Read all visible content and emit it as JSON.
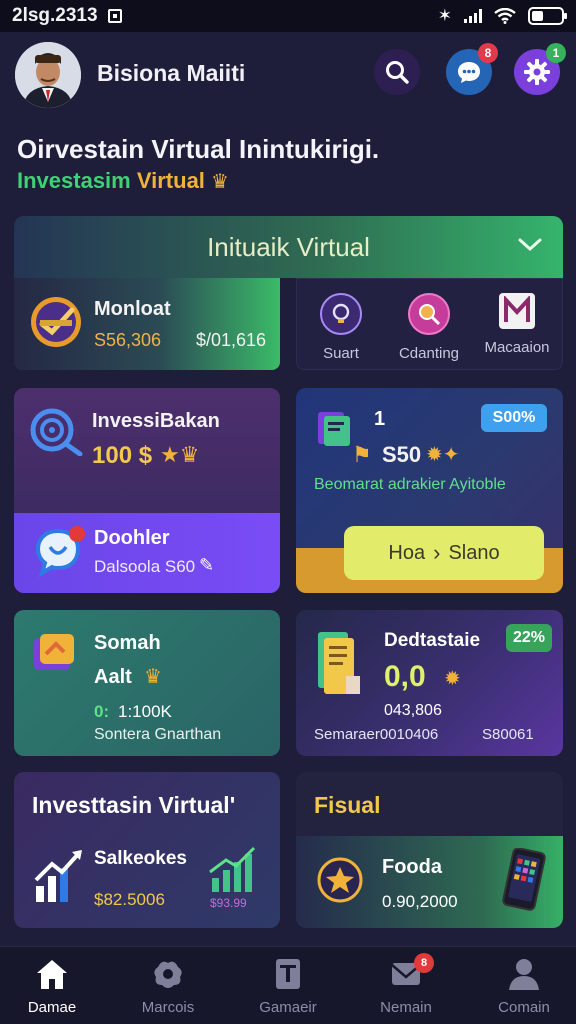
{
  "status_bar": {
    "time": "2lsg.2313"
  },
  "header": {
    "username": "Bisiona Maiiti",
    "chat_badge": "8",
    "settings_badge": "1"
  },
  "welcome": {
    "title": "Oirvestain Virtual Inintukirigi.",
    "subtitle_green": "Investasim",
    "subtitle_yellow": "Virtual"
  },
  "section": {
    "title": "Inituaik Virtual"
  },
  "market_card": {
    "title": "Monloat",
    "value_left": "S56,306",
    "value_right": "$/01,616"
  },
  "actions": [
    {
      "label": "Suart",
      "icon": "lightbulb-icon"
    },
    {
      "label": "Cdanting",
      "icon": "search-chart-icon"
    },
    {
      "label": "Macaaion",
      "icon": "m-logo-icon"
    }
  ],
  "invest_card": {
    "title": "InvessiBakan",
    "amount": "100 $",
    "sub_title": "Doohler",
    "sub_value": "Dalsoola S60"
  },
  "offer_card": {
    "count": "1",
    "price_badge": "S00%",
    "value": "S50",
    "description": "Beomarat adrakier Ayitoble",
    "button_left": "Hoa",
    "button_right": "Slano"
  },
  "saving_card": {
    "title": "Somah",
    "subtitle": "Aalt",
    "goal_prefix": "0:",
    "goal_value": "1:100K",
    "footer": "Sontera Gnarthan"
  },
  "stats_card": {
    "title": "Dedtastaie",
    "badge": "22%",
    "value": "0,0",
    "sub_value": "043,806",
    "footer_left": "Semaraer0010406",
    "footer_right": "S80061"
  },
  "virtual_card": {
    "title": "Investtasin Virtual'",
    "subtitle": "Salkeokes",
    "value": "$82.5006",
    "value_right": "$93.99"
  },
  "fisual_card": {
    "title": "Fisual",
    "item_title": "Fooda",
    "item_value": "0.90,2000"
  },
  "nav": [
    {
      "label": "Damae",
      "icon": "home-icon",
      "active": true
    },
    {
      "label": "Marcois",
      "icon": "gear-blob-icon",
      "active": false
    },
    {
      "label": "Gamaeir",
      "icon": "document-icon",
      "active": false
    },
    {
      "label": "Nemain",
      "icon": "mail-icon",
      "active": false,
      "badge": "8"
    },
    {
      "label": "Comain",
      "icon": "user-icon",
      "active": false
    }
  ],
  "colors": {
    "background": "#1f1e3a",
    "accent_green": "#3fd174",
    "accent_yellow": "#f1b23a",
    "accent_purple": "#7b3fdc"
  }
}
